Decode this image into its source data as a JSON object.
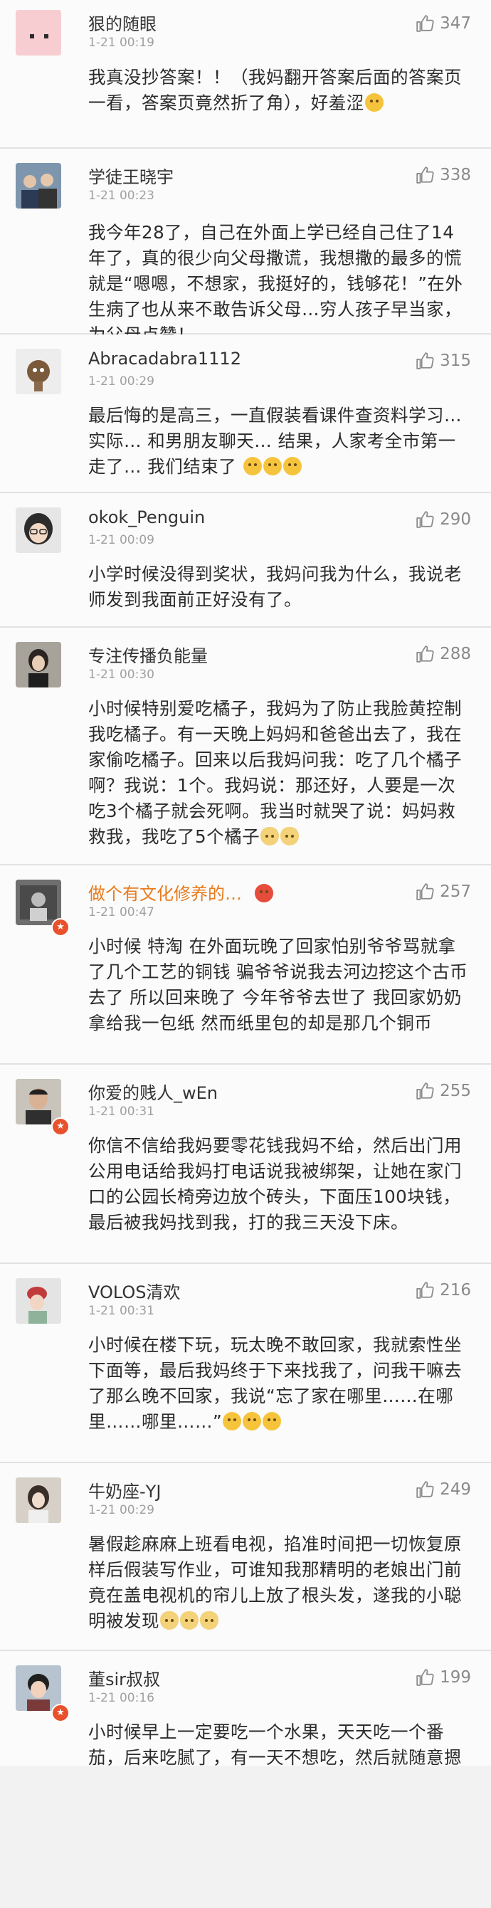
{
  "comments": [
    {
      "user": "狠的随眼",
      "time": "1-21 00:19",
      "likes": "347",
      "text": "我真没抄答案！！（我妈翻开答案后面的答案页一看，答案页竟然折了角），好羞涩",
      "emoji": [
        "laugh-cry"
      ]
    },
    {
      "user": "学徒王晓宇",
      "time": "1-21 00:23",
      "likes": "338",
      "text": "我今年28了，自己在外面上学已经自己住了14年了，真的很少向父母撒谎，我想撒的最多的慌就是“嗯嗯，不想家，我挺好的，钱够花！”在外生病了也从来不敢告诉父母…穷人孩子早当家，为父母点赞！"
    },
    {
      "user": "Abracadabra1112",
      "time": "1-21 00:29",
      "likes": "315",
      "text": "最后悔的是高三，一直假装看课件查资料学习… 实际… 和男朋友聊天… 结果，人家考全市第一走了… 我们结束了",
      "emoji": [
        "smile",
        "smile",
        "smile"
      ]
    },
    {
      "user": "okok_Penguin",
      "time": "1-21 00:09",
      "likes": "290",
      "text": "小学时候没得到奖状，我妈问我为什么，我说老师发到我面前正好没有了。"
    },
    {
      "user": "专注传播负能量",
      "time": "1-21 00:30",
      "likes": "288",
      "text": "小时候特别爱吃橘子，我妈为了防止我脸黄控制我吃橘子。有一天晚上妈妈和爸爸出去了，我在家偷吃橘子。回来以后我妈问我：吃了几个橘子啊？我说：1个。我妈说：那还好，人要是一次吃3个橘子就会死啊。我当时就哭了说：妈妈救救我，我吃了5个橘子",
      "emoji": [
        "cat",
        "cat"
      ]
    },
    {
      "user": "做个有文化修养的…",
      "time": "1-21 00:47",
      "likes": "257",
      "text": "小时候 特淘 在外面玩晚了回家怕别爷爷骂就拿了几个工艺的铜钱 骗爷爷说我去河边挖这个古币去了 所以回来晚了 今年爷爷去世了 我回家奶奶拿给我一包纸 然而纸里包的却是那几个铜币"
    },
    {
      "user": "你爱的贱人_wEn",
      "time": "1-21 00:31",
      "likes": "255",
      "text": "你信不信给我妈要零花钱我妈不给，然后出门用公用电话给我妈打电话说我被绑架，让她在家门口的公园长椅旁边放个砖头，下面压100块钱，最后被我妈找到我，打的我三天没下床。"
    },
    {
      "user": "VOLOS清欢",
      "time": "1-21 00:31",
      "likes": "216",
      "text": "小时候在楼下玩，玩太晚不敢回家，我就索性坐下面等，最后我妈终于下来找我了，问我干嘛去了那么晚不回家，我说“忘了家在哪里……在哪里……哪里……”",
      "emoji": [
        "laugh-cry",
        "laugh-cry",
        "laugh-cry"
      ]
    },
    {
      "user": "牛奶座-YJ",
      "time": "1-21 00:29",
      "likes": "249",
      "text": "暑假趁麻麻上班看电视，掐准时间把一切恢复原样后假装写作业，可谁知我那精明的老娘出门前竟在盖电视机的帘儿上放了根头发，遂我的小聪明被发现",
      "emoji": [
        "cat",
        "cat",
        "cat"
      ]
    },
    {
      "user": "董sir叔叔",
      "time": "1-21 00:16",
      "likes": "199",
      "text": "小时候早上一定要吃一个水果，天天吃一个番茄，后来吃腻了，有一天不想吃，然后就随意摁墙上了，妈妈问番茄呢，我说吃完了，那墙上那个是什么！然后就被打了…",
      "emoji": [
        "cat"
      ]
    }
  ]
}
